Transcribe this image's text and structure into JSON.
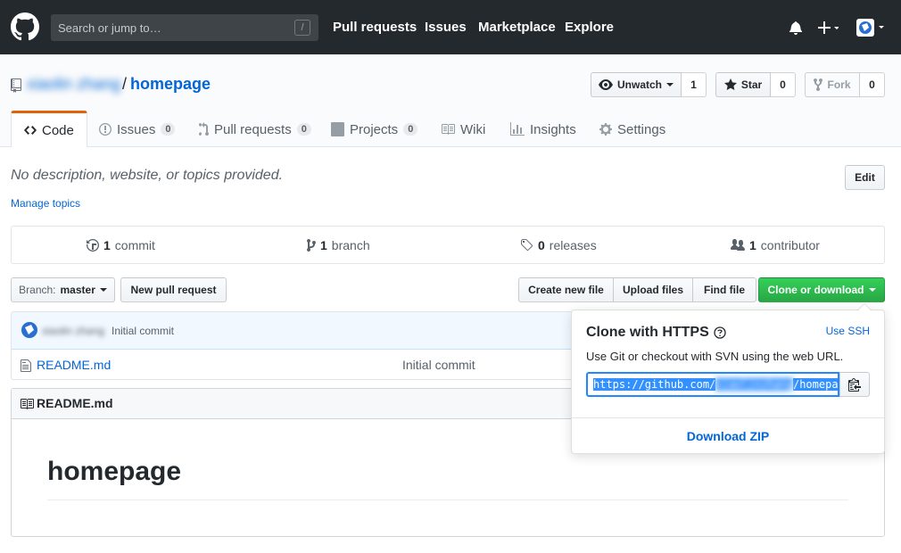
{
  "header": {
    "search_placeholder": "Search or jump to…",
    "search_shortcut": "/",
    "nav": [
      "Pull requests",
      "Issues",
      "Marketplace",
      "Explore"
    ]
  },
  "repo": {
    "owner": "xiaolin zhang",
    "separator": "/",
    "name": "homepage",
    "unwatch_label": "Unwatch",
    "unwatch_count": "1",
    "star_label": "Star",
    "star_count": "0",
    "fork_label": "Fork",
    "fork_count": "0"
  },
  "tabs": [
    {
      "label": "Code"
    },
    {
      "label": "Issues",
      "count": "0"
    },
    {
      "label": "Pull requests",
      "count": "0"
    },
    {
      "label": "Projects",
      "count": "0"
    },
    {
      "label": "Wiki"
    },
    {
      "label": "Insights"
    },
    {
      "label": "Settings"
    }
  ],
  "description": {
    "text": "No description, website, or topics provided.",
    "edit_label": "Edit",
    "manage_topics": "Manage topics"
  },
  "summary": {
    "commits_num": "1",
    "commits_label": "commit",
    "branches_num": "1",
    "branches_label": "branch",
    "releases_num": "0",
    "releases_label": "releases",
    "contributors_num": "1",
    "contributors_label": "contributor"
  },
  "file_nav": {
    "branch_prefix": "Branch:",
    "branch_name": "master",
    "new_pr": "New pull request",
    "create_file": "Create new file",
    "upload_files": "Upload files",
    "find_file": "Find file",
    "clone": "Clone or download"
  },
  "commit": {
    "author": "xiaolin zhang",
    "message": "Initial commit"
  },
  "files": [
    {
      "name": "README.md",
      "message": "Initial commit"
    }
  ],
  "readme": {
    "title": "README.md",
    "heading": "homepage"
  },
  "clone_popover": {
    "title": "Clone with HTTPS",
    "use_ssh": "Use SSH",
    "description": "Use Git or checkout with SVN using the web URL.",
    "url_prefix": "https://github.com/",
    "url_owner": "xiaolinzhang",
    "url_suffix": "/homepage.git",
    "download_zip": "Download ZIP"
  },
  "colors": {
    "header_bg": "#24292e",
    "link": "#0366d6",
    "green": "#28a745",
    "tab_accent": "#e36209"
  }
}
